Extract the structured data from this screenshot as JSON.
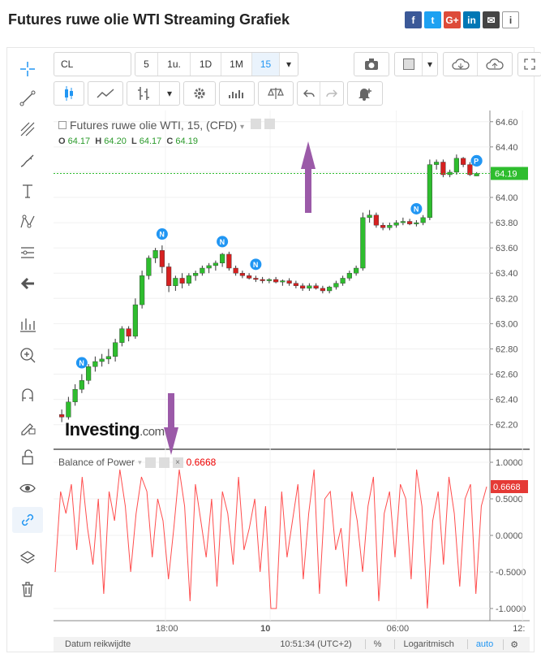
{
  "page": {
    "title": "Futures ruwe olie WTI Streaming Grafiek"
  },
  "share": [
    "f",
    "t",
    "G+",
    "in",
    "✉",
    "i"
  ],
  "toolbar": {
    "symbol": "CL",
    "intervals": [
      "5",
      "1u.",
      "1D",
      "1M",
      "15"
    ],
    "active_interval": "15"
  },
  "main_legend": {
    "title": "Futures ruwe olie WTI, 15, (CFD)",
    "o_label": "O",
    "o": "64.17",
    "h_label": "H",
    "h": "64.20",
    "l_label": "L",
    "l": "64.17",
    "c_label": "C",
    "c": "64.19"
  },
  "bop_legend": {
    "title": "Balance of Power",
    "value": "0.6668"
  },
  "watermark": {
    "brand": "Investing",
    "suffix": ".com"
  },
  "bottom": {
    "range_label": "Datum reikwijdte",
    "time": "10:51:34 (UTC+2)",
    "percent": "%",
    "log": "Logaritmisch",
    "auto": "auto"
  },
  "colors": {
    "up": "#2ebd2e",
    "down": "#d62020",
    "accent": "#2196f3",
    "bop_line": "#ff4d4d",
    "price_line": "#2ebd2e",
    "arrow": "#9b5aa8"
  },
  "chart_data": [
    {
      "type": "candlestick",
      "title": "Futures ruwe olie WTI, 15, (CFD)",
      "y_ticks": [
        "64.60",
        "64.40",
        "64.20",
        "64.00",
        "63.80",
        "63.60",
        "63.40",
        "63.20",
        "63.00",
        "62.80",
        "62.60",
        "62.40",
        "62.20"
      ],
      "ylim": [
        62.05,
        64.65
      ],
      "last_price": "64.19",
      "x_ticks": [
        "18:00",
        "10",
        "06:00",
        "12:"
      ],
      "ohlc": [
        [
          62.28,
          62.32,
          62.22,
          62.26
        ],
        [
          62.26,
          62.42,
          62.24,
          62.38
        ],
        [
          62.38,
          62.52,
          62.35,
          62.48
        ],
        [
          62.48,
          62.6,
          62.45,
          62.55
        ],
        [
          62.55,
          62.68,
          62.52,
          62.66
        ],
        [
          62.66,
          62.74,
          62.62,
          62.7
        ],
        [
          62.7,
          62.76,
          62.66,
          62.72
        ],
        [
          62.72,
          62.8,
          62.68,
          62.74
        ],
        [
          62.74,
          62.88,
          62.7,
          62.85
        ],
        [
          62.85,
          62.98,
          62.82,
          62.96
        ],
        [
          62.96,
          62.98,
          62.86,
          62.9
        ],
        [
          62.9,
          63.2,
          62.88,
          63.15
        ],
        [
          63.15,
          63.42,
          63.12,
          63.38
        ],
        [
          63.38,
          63.54,
          63.35,
          63.52
        ],
        [
          63.52,
          63.6,
          63.48,
          63.58
        ],
        [
          63.58,
          63.62,
          63.4,
          63.45
        ],
        [
          63.45,
          63.48,
          63.25,
          63.3
        ],
        [
          63.3,
          63.38,
          63.26,
          63.36
        ],
        [
          63.36,
          63.4,
          63.28,
          63.32
        ],
        [
          63.32,
          63.4,
          63.3,
          63.38
        ],
        [
          63.38,
          63.42,
          63.34,
          63.4
        ],
        [
          63.4,
          63.46,
          63.38,
          63.44
        ],
        [
          63.44,
          63.48,
          63.4,
          63.46
        ],
        [
          63.46,
          63.5,
          63.42,
          63.48
        ],
        [
          63.48,
          63.56,
          63.45,
          63.55
        ],
        [
          63.55,
          63.57,
          63.42,
          63.44
        ],
        [
          63.44,
          63.46,
          63.38,
          63.4
        ],
        [
          63.4,
          63.42,
          63.36,
          63.38
        ],
        [
          63.38,
          63.4,
          63.35,
          63.36
        ],
        [
          63.36,
          63.38,
          63.33,
          63.35
        ],
        [
          63.35,
          63.37,
          63.32,
          63.34
        ],
        [
          63.34,
          63.36,
          63.32,
          63.35
        ],
        [
          63.35,
          63.37,
          63.32,
          63.33
        ],
        [
          63.33,
          63.35,
          63.3,
          63.34
        ],
        [
          63.34,
          63.36,
          63.3,
          63.32
        ],
        [
          63.32,
          63.34,
          63.28,
          63.3
        ],
        [
          63.3,
          63.32,
          63.26,
          63.28
        ],
        [
          63.28,
          63.32,
          63.26,
          63.3
        ],
        [
          63.3,
          63.32,
          63.27,
          63.28
        ],
        [
          63.28,
          63.3,
          63.24,
          63.26
        ],
        [
          63.26,
          63.3,
          63.24,
          63.29
        ],
        [
          63.29,
          63.34,
          63.27,
          63.32
        ],
        [
          63.32,
          63.38,
          63.3,
          63.36
        ],
        [
          63.36,
          63.42,
          63.34,
          63.4
        ],
        [
          63.4,
          63.46,
          63.38,
          63.44
        ],
        [
          63.44,
          63.88,
          63.42,
          63.84
        ],
        [
          63.84,
          63.9,
          63.8,
          63.86
        ],
        [
          63.86,
          63.88,
          63.76,
          63.78
        ],
        [
          63.78,
          63.8,
          63.74,
          63.76
        ],
        [
          63.76,
          63.8,
          63.74,
          63.78
        ],
        [
          63.78,
          63.82,
          63.76,
          63.8
        ],
        [
          63.8,
          63.84,
          63.78,
          63.81
        ],
        [
          63.81,
          63.83,
          63.78,
          63.79
        ],
        [
          63.79,
          63.82,
          63.77,
          63.8
        ],
        [
          63.8,
          63.86,
          63.78,
          63.84
        ],
        [
          63.84,
          64.3,
          63.82,
          64.26
        ],
        [
          64.26,
          64.3,
          64.22,
          64.28
        ],
        [
          64.28,
          64.3,
          64.16,
          64.18
        ],
        [
          64.18,
          64.22,
          64.16,
          64.2
        ],
        [
          64.2,
          64.34,
          64.18,
          64.31
        ],
        [
          64.31,
          64.32,
          64.24,
          64.26
        ],
        [
          64.26,
          64.28,
          64.17,
          64.18
        ],
        [
          64.17,
          64.2,
          64.17,
          64.19
        ]
      ],
      "markers": [
        {
          "label": "N",
          "index": 3
        },
        {
          "label": "N",
          "index": 15
        },
        {
          "label": "N",
          "index": 24
        },
        {
          "label": "N",
          "index": 29
        },
        {
          "label": "N",
          "index": 53
        },
        {
          "label": "P",
          "index": 74
        },
        {
          "label": "P",
          "index": 79
        }
      ]
    },
    {
      "type": "line",
      "title": "Balance of Power",
      "y_ticks": [
        "1.0000",
        "0.5000",
        "0.0000",
        "-0.5000",
        "-1.0000"
      ],
      "ylim": [
        -1.1,
        1.1
      ],
      "last_value": "0.6668",
      "values": [
        -0.5,
        0.6,
        0.3,
        0.7,
        -0.2,
        0.8,
        0.1,
        -0.4,
        0.5,
        -0.8,
        0.6,
        0.2,
        0.9,
        0.4,
        -0.5,
        0.3,
        0.8,
        0.6,
        -0.3,
        0.5,
        0.2,
        -0.6,
        0.1,
        0.9,
        0.4,
        -0.9,
        0.7,
        0.2,
        -0.3,
        0.5,
        -0.7,
        0.6,
        0.3,
        -0.4,
        0.8,
        -0.2,
        0.1,
        0.5,
        -0.5,
        0.4,
        -1.0,
        -1.0,
        0.6,
        -0.3,
        0.2,
        0.7,
        -0.6,
        0.3,
        0.9,
        -0.8,
        0.5,
        0.6,
        -0.2,
        0.1,
        -0.7,
        0.6,
        0.2,
        -0.5,
        0.4,
        0.8,
        -0.9,
        0.3,
        0.6,
        -0.3,
        0.7,
        0.5,
        -0.6,
        0.9,
        0.4,
        -1.0,
        0.2,
        0.6,
        -0.4,
        0.8,
        0.3,
        -0.7,
        0.5,
        0.7,
        -0.8,
        0.4,
        0.6667
      ]
    }
  ]
}
